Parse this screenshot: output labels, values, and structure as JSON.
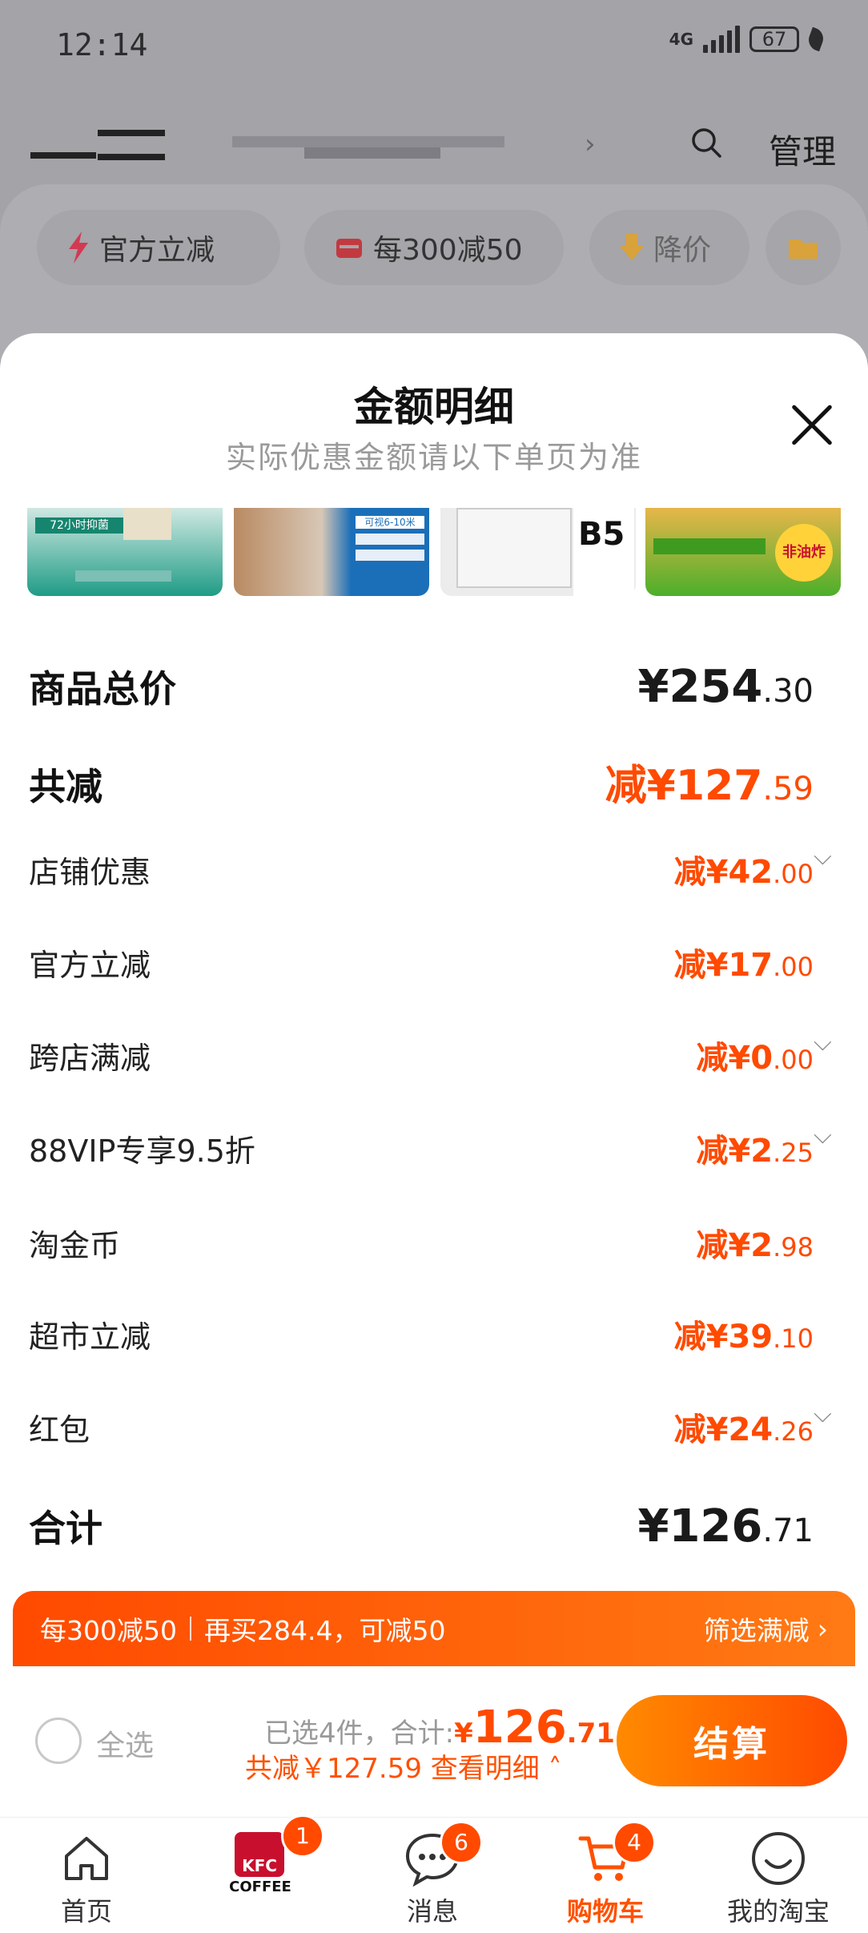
{
  "status_bar": {
    "time": "12:14",
    "network": "4G",
    "battery": "67"
  },
  "header": {
    "manage_label": "管理"
  },
  "chips": [
    {
      "label": "官方立减",
      "icon": "lightning-icon"
    },
    {
      "label": "每300减50",
      "icon": "shop-icon"
    },
    {
      "label": "降价",
      "icon": "price-drop-icon"
    },
    {
      "label": "",
      "icon": "folder-icon"
    }
  ],
  "sheet": {
    "title": "金额明细",
    "subtitle": "实际优惠金额请以下单页为准",
    "thumbs": [
      {
        "badge_text": "72小时抑菌"
      },
      {
        "badge_text": "可视6-10米"
      },
      {
        "badge_text": "B5"
      },
      {
        "badge_text": "非油炸"
      }
    ],
    "rows": [
      {
        "label": "商品总价",
        "prefix": "",
        "currency": "¥",
        "integer": "254",
        "decimal": ".30",
        "expandable": false,
        "big": true,
        "highlight": false
      },
      {
        "label": "共减",
        "prefix": "减",
        "currency": "¥",
        "integer": "127",
        "decimal": ".59",
        "expandable": false,
        "big": true,
        "highlight": true
      },
      {
        "label": "店铺优惠",
        "prefix": "减",
        "currency": "¥",
        "integer": "42",
        "decimal": ".00",
        "expandable": true,
        "big": false,
        "highlight": true
      },
      {
        "label": "官方立减",
        "prefix": "减",
        "currency": "¥",
        "integer": "17",
        "decimal": ".00",
        "expandable": false,
        "big": false,
        "highlight": true
      },
      {
        "label": "跨店满减",
        "prefix": "减",
        "currency": "¥",
        "integer": "0",
        "decimal": ".00",
        "expandable": true,
        "big": false,
        "highlight": true
      },
      {
        "label": "88VIP专享9.5折",
        "prefix": "减",
        "currency": "¥",
        "integer": "2",
        "decimal": ".25",
        "expandable": true,
        "big": false,
        "highlight": true
      },
      {
        "label": "淘金币",
        "prefix": "减",
        "currency": "¥",
        "integer": "2",
        "decimal": ".98",
        "expandable": false,
        "big": false,
        "highlight": true
      },
      {
        "label": "超市立减",
        "prefix": "减",
        "currency": "¥",
        "integer": "39",
        "decimal": ".10",
        "expandable": false,
        "big": false,
        "highlight": true
      },
      {
        "label": "红包",
        "prefix": "减",
        "currency": "¥",
        "integer": "24",
        "decimal": ".26",
        "expandable": true,
        "big": false,
        "highlight": true
      },
      {
        "label": "合计",
        "prefix": "",
        "currency": "¥",
        "integer": "126",
        "decimal": ".71",
        "expandable": false,
        "big": true,
        "highlight": false
      }
    ]
  },
  "promo": {
    "rule": "每300减50",
    "hint": "再买284.4，可减50",
    "filter_label": "筛选满减"
  },
  "checkout": {
    "select_all": "全选",
    "selected_text": "已选4件，合计:",
    "total_currency": "¥",
    "total_integer": "126",
    "total_decimal": ".71",
    "saved_text": "共减￥127.59 查看明细",
    "pay_label": "结算"
  },
  "tabbar": [
    {
      "label": "首页",
      "icon": "home-icon",
      "badge": ""
    },
    {
      "label": "",
      "icon": "kfc-coffee-icon",
      "badge": "1"
    },
    {
      "label": "消息",
      "icon": "message-icon",
      "badge": "6"
    },
    {
      "label": "购物车",
      "icon": "cart-icon",
      "badge": "4"
    },
    {
      "label": "我的淘宝",
      "icon": "profile-icon",
      "badge": ""
    }
  ],
  "colors": {
    "accent": "#ff4a00",
    "accent_light": "#ff8a00"
  }
}
